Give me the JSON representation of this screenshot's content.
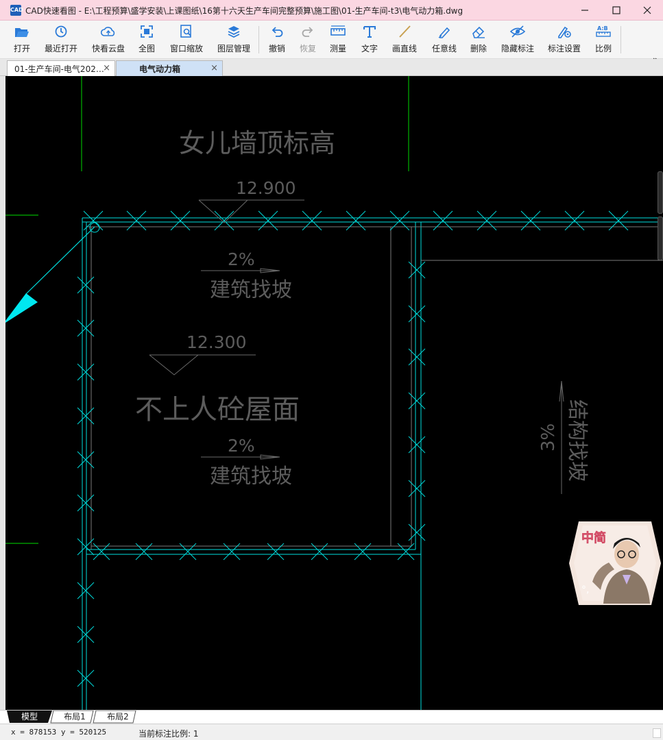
{
  "window": {
    "icon_text": "CAD",
    "title": "CAD快速看图 - E:\\工程预算\\盛学安装\\上课图纸\\16第十六天生产车间完整预算\\施工图\\01-生产车间-t3\\电气动力箱.dwg"
  },
  "toolbar": {
    "items": [
      {
        "label": "打开",
        "icon": "folder-open-icon"
      },
      {
        "label": "最近打开",
        "icon": "history-icon"
      },
      {
        "label": "快看云盘",
        "icon": "cloud-icon"
      },
      {
        "label": "全图",
        "icon": "fit-all-icon"
      },
      {
        "label": "窗口缩放",
        "icon": "zoom-window-icon"
      },
      {
        "label": "图层管理",
        "icon": "layers-icon"
      },
      {
        "label": "撤销",
        "icon": "undo-icon"
      },
      {
        "label": "恢复",
        "icon": "redo-icon"
      },
      {
        "label": "测量",
        "icon": "ruler-icon"
      },
      {
        "label": "文字",
        "icon": "text-icon"
      },
      {
        "label": "画直线",
        "icon": "line-icon"
      },
      {
        "label": "任意线",
        "icon": "pen-icon"
      },
      {
        "label": "删除",
        "icon": "eraser-icon"
      },
      {
        "label": "隐藏标注",
        "icon": "eye-hide-icon"
      },
      {
        "label": "标注设置",
        "icon": "annotation-settings-icon"
      },
      {
        "label": "比例",
        "icon": "scale-icon"
      }
    ],
    "more": "»"
  },
  "tabs": [
    {
      "label": "01-生产车间-电气202…",
      "close": "×"
    },
    {
      "label": "电气动力箱",
      "close": "×",
      "active": true
    }
  ],
  "drawing": {
    "parapet_label": "女儿墙顶标高",
    "elev_top": "12.900",
    "slope1_pct": "2%",
    "slope1_text": "建筑找坡",
    "elev_roof": "12.300",
    "roof_label": "不上人砼屋面",
    "slope2_pct": "2%",
    "slope2_text": "建筑找坡",
    "slope3_pct": "3%",
    "slope3_text": "结构找坡"
  },
  "avatar": {
    "caption": "中简",
    "sub": "°,"
  },
  "layout_tabs": [
    "模型",
    "布局1",
    "布局2"
  ],
  "status": {
    "coords": "x = 878153  y = 520125",
    "ratio": "当前标注比例: 1"
  },
  "colors": {
    "cyan": "#00e5e5",
    "green": "#00c000",
    "gray_text": "#5c5c5c",
    "titlebar": "#fbd7e2"
  }
}
